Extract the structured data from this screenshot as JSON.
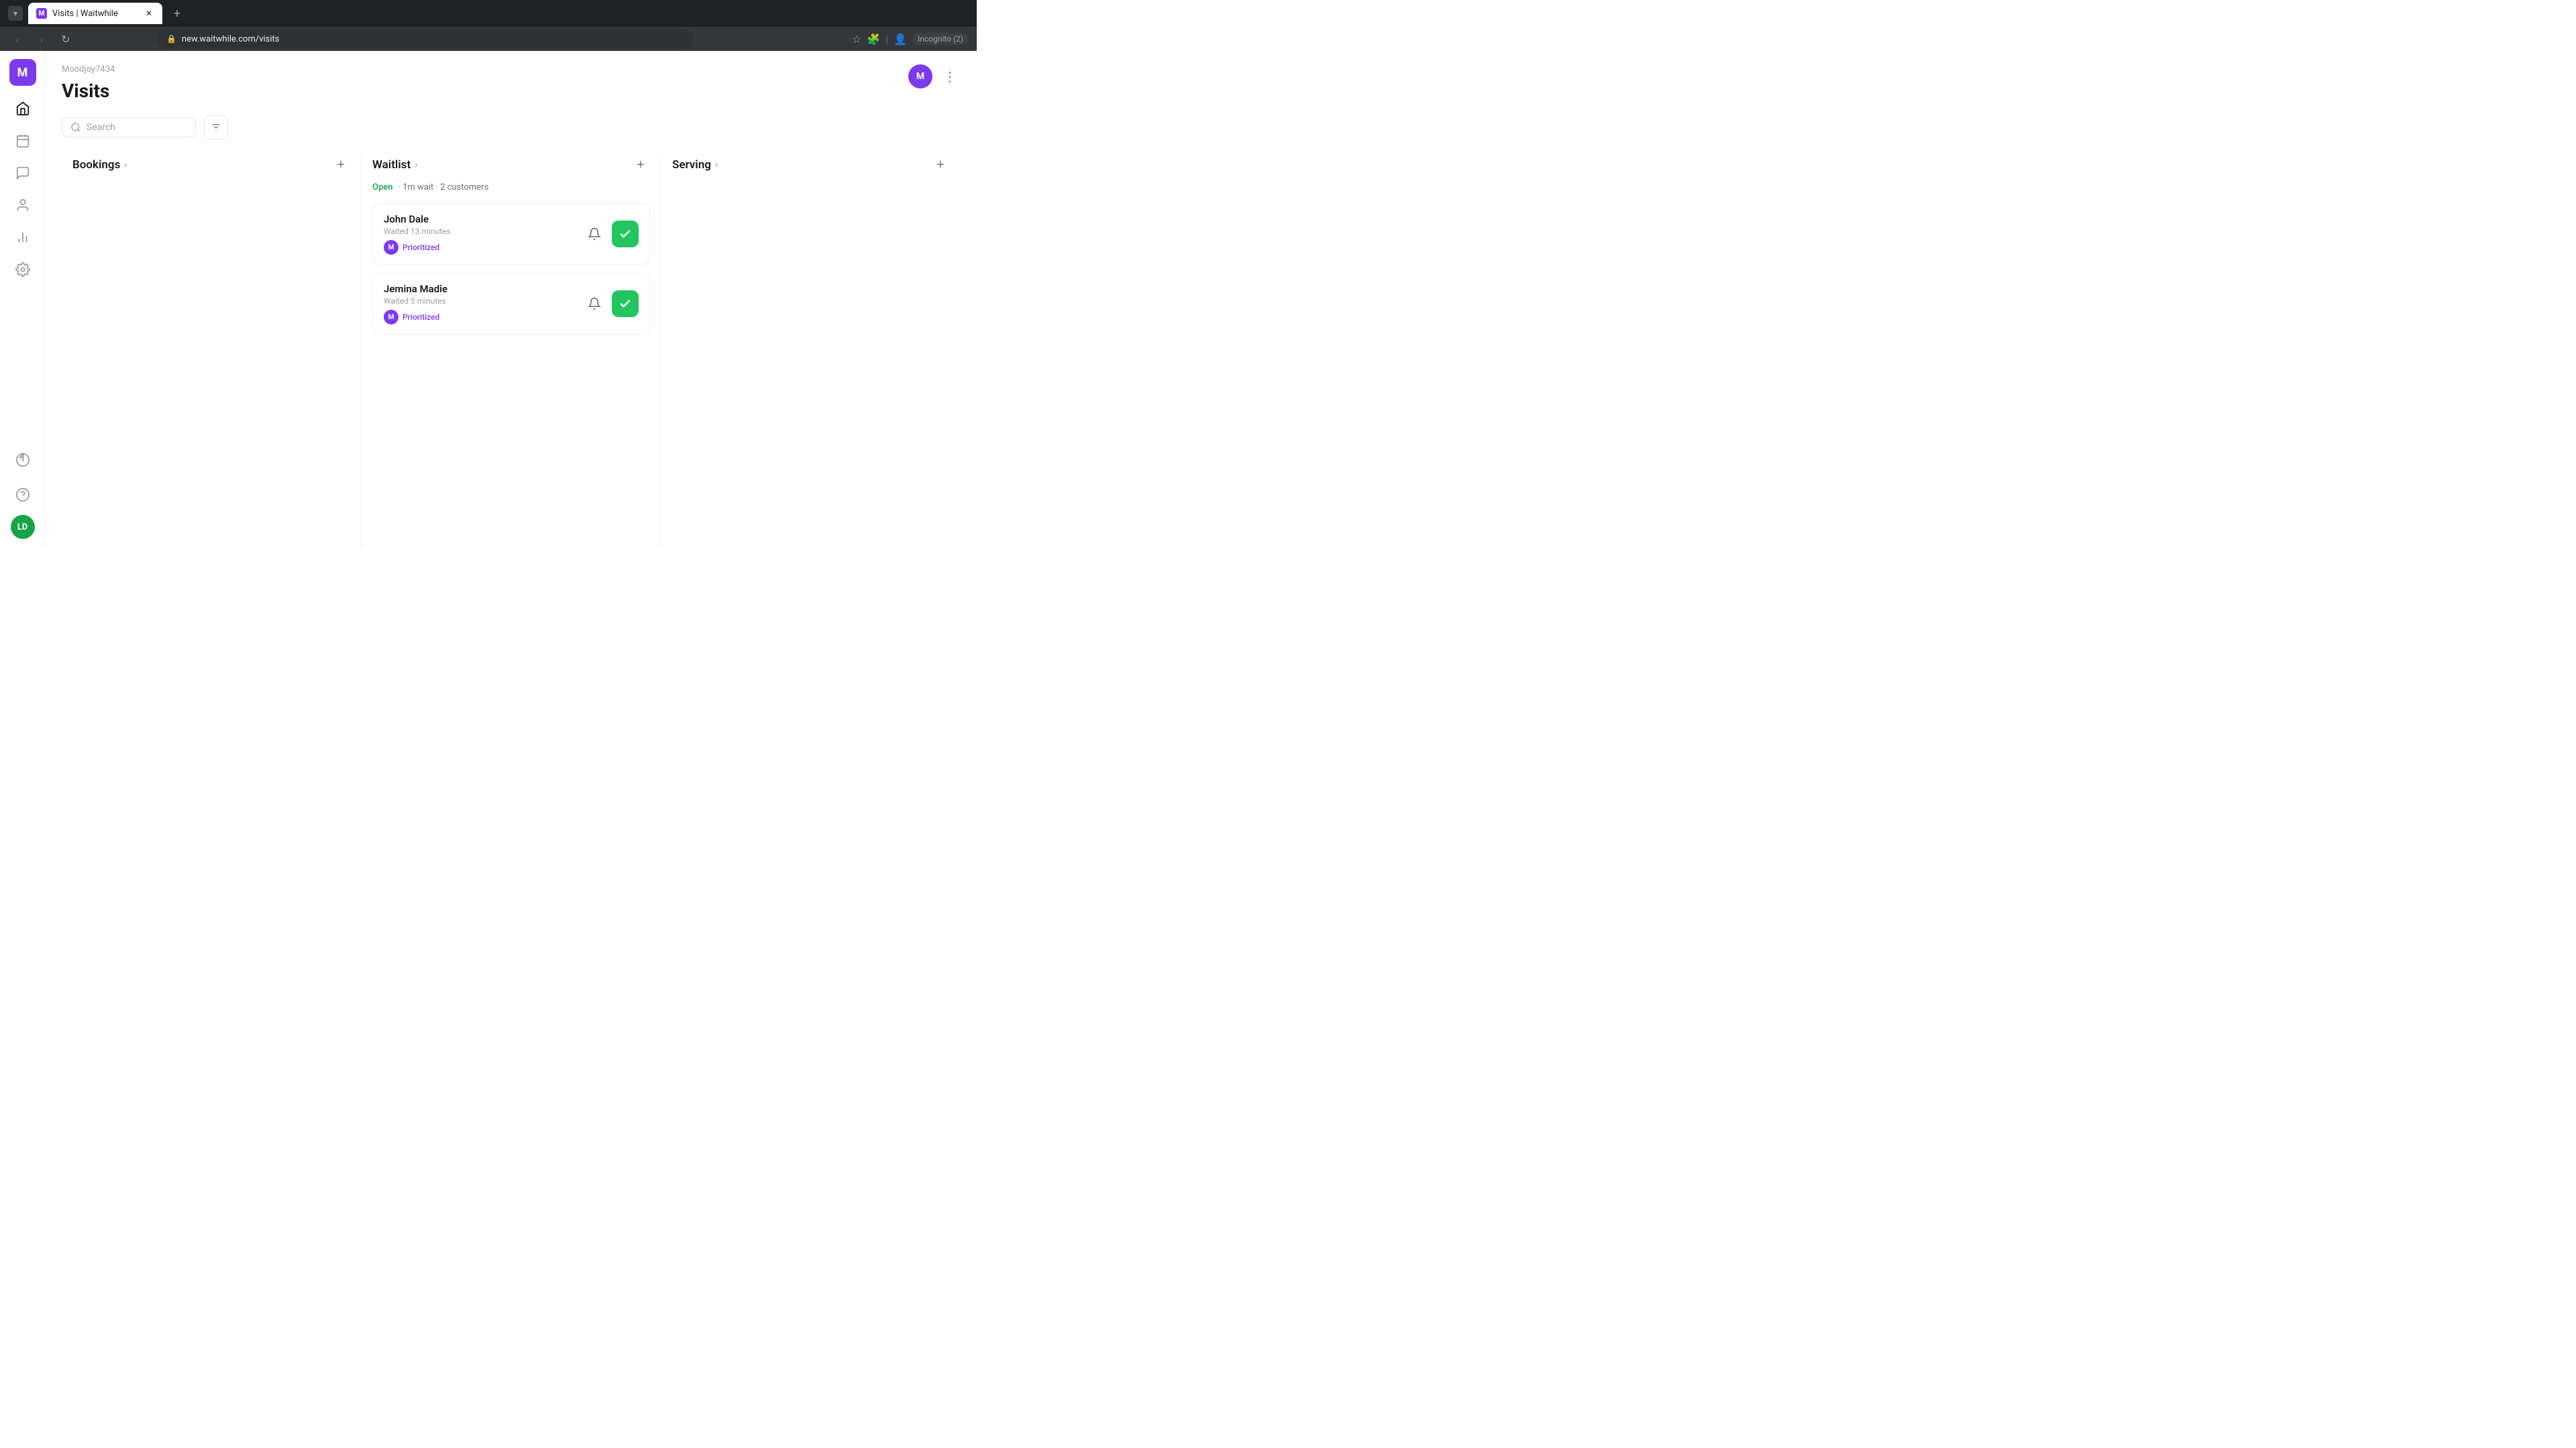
{
  "browser": {
    "tab_title": "Visits | Waitwhile",
    "tab_favicon": "M",
    "url": "new.waitwhile.com/visits",
    "incognito_label": "Incognito (2)"
  },
  "sidebar": {
    "logo_letter": "M",
    "items": [
      {
        "id": "home",
        "icon": "⌂",
        "label": "Home"
      },
      {
        "id": "calendar",
        "icon": "▦",
        "label": "Calendar"
      },
      {
        "id": "chat",
        "icon": "💬",
        "label": "Messages"
      },
      {
        "id": "users",
        "icon": "👤",
        "label": "Customers"
      },
      {
        "id": "analytics",
        "icon": "📊",
        "label": "Analytics"
      },
      {
        "id": "settings",
        "icon": "⚙",
        "label": "Settings"
      }
    ],
    "bottom": [
      {
        "id": "bolt",
        "icon": "⚡",
        "label": "Quick actions"
      },
      {
        "id": "help",
        "icon": "?",
        "label": "Help"
      }
    ],
    "user_initials": "LD"
  },
  "page": {
    "org_name": "Moodjoy7434",
    "title": "Visits",
    "user_avatar_letter": "M",
    "search_placeholder": "Search"
  },
  "columns": {
    "bookings": {
      "title": "Bookings",
      "add_label": "+"
    },
    "waitlist": {
      "title": "Waitlist",
      "add_label": "+",
      "status": "Open",
      "status_detail": "· 1m wait · 2 customers",
      "customers": [
        {
          "name": "John Dale",
          "wait": "Waited 13 minutes",
          "tag_initial": "M",
          "tag_label": "Prioritized"
        },
        {
          "name": "Jemina Madie",
          "wait": "Waited 5 minutes",
          "tag_initial": "M",
          "tag_label": "Prioritized"
        }
      ]
    },
    "serving": {
      "title": "Serving",
      "add_label": "+"
    }
  }
}
